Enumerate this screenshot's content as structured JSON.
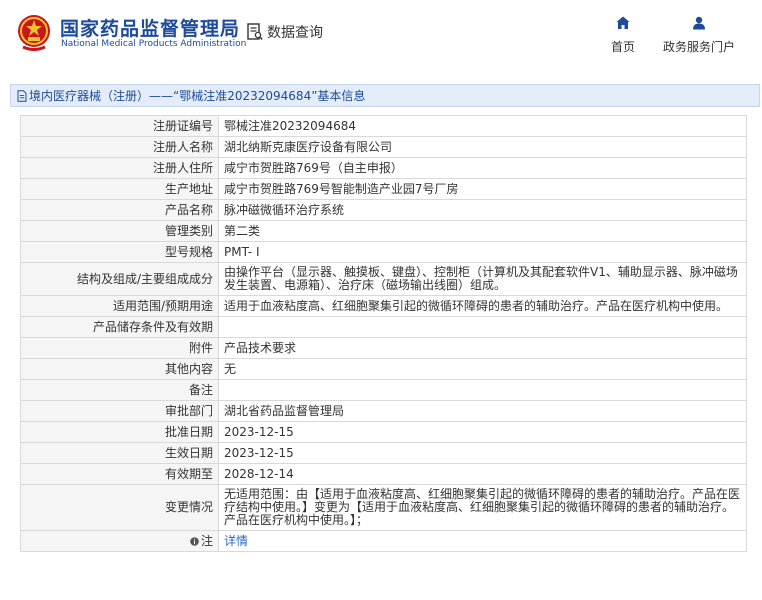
{
  "header": {
    "agency_cn": "国家药品监督管理局",
    "agency_en": "National Medical Products Administration",
    "db_query": "数据查询",
    "nav": [
      {
        "label": "首页",
        "icon": "home-icon"
      },
      {
        "label": "政务服务门户",
        "icon": "user-icon"
      }
    ]
  },
  "title_bar": {
    "text": "境内医疗器械（注册）——“鄂械注准20232094684”基本信息",
    "icon": "document-icon"
  },
  "rows": [
    {
      "label": "注册证编号",
      "value": "鄂械注准20232094684"
    },
    {
      "label": "注册人名称",
      "value": "湖北纳斯克康医疗设备有限公司"
    },
    {
      "label": "注册人住所",
      "value": "咸宁市贺胜路769号（自主申报）"
    },
    {
      "label": "生产地址",
      "value": "咸宁市贺胜路769号智能制造产业园7号厂房"
    },
    {
      "label": "产品名称",
      "value": "脉冲磁微循环治疗系统"
    },
    {
      "label": "管理类别",
      "value": "第二类"
    },
    {
      "label": "型号规格",
      "value": "PMT- I"
    },
    {
      "label": "结构及组成/主要组成成分",
      "value": "由操作平台（显示器、触摸板、键盘）、控制柜（计算机及其配套软件V1、辅助显示器、脉冲磁场发生装置、电源箱）、治疗床（磁场输出线圈）组成。"
    },
    {
      "label": "适用范围/预期用途",
      "value": "适用于血液粘度高、红细胞聚集引起的微循环障碍的患者的辅助治疗。产品在医疗机构中使用。"
    },
    {
      "label": "产品储存条件及有效期",
      "value": ""
    },
    {
      "label": "附件",
      "value": "产品技术要求"
    },
    {
      "label": "其他内容",
      "value": "无"
    },
    {
      "label": "备注",
      "value": ""
    },
    {
      "label": "审批部门",
      "value": "湖北省药品监督管理局"
    },
    {
      "label": "批准日期",
      "value": "2023-12-15"
    },
    {
      "label": "生效日期",
      "value": "2023-12-15"
    },
    {
      "label": "有效期至",
      "value": "2028-12-14"
    },
    {
      "label": "变更情况",
      "value": "无适用范围：由【适用于血液粘度高、红细胞聚集引起的微循环障碍的患者的辅助治疗。产品在医疗结构中使用。】变更为【适用于血液粘度高、红细胞聚集引起的微循环障碍的患者的辅助治疗。产品在医疗机构中使用。】；"
    }
  ],
  "note_row": {
    "label": "注",
    "icon": "info-icon",
    "link": "详情"
  },
  "colors": {
    "brand_blue": "#1d4b99",
    "link_blue": "#2c69c7",
    "emblem_red": "#c8161d",
    "emblem_gold": "#f2c12e",
    "title_bar_bg": "#e3ecf8"
  }
}
